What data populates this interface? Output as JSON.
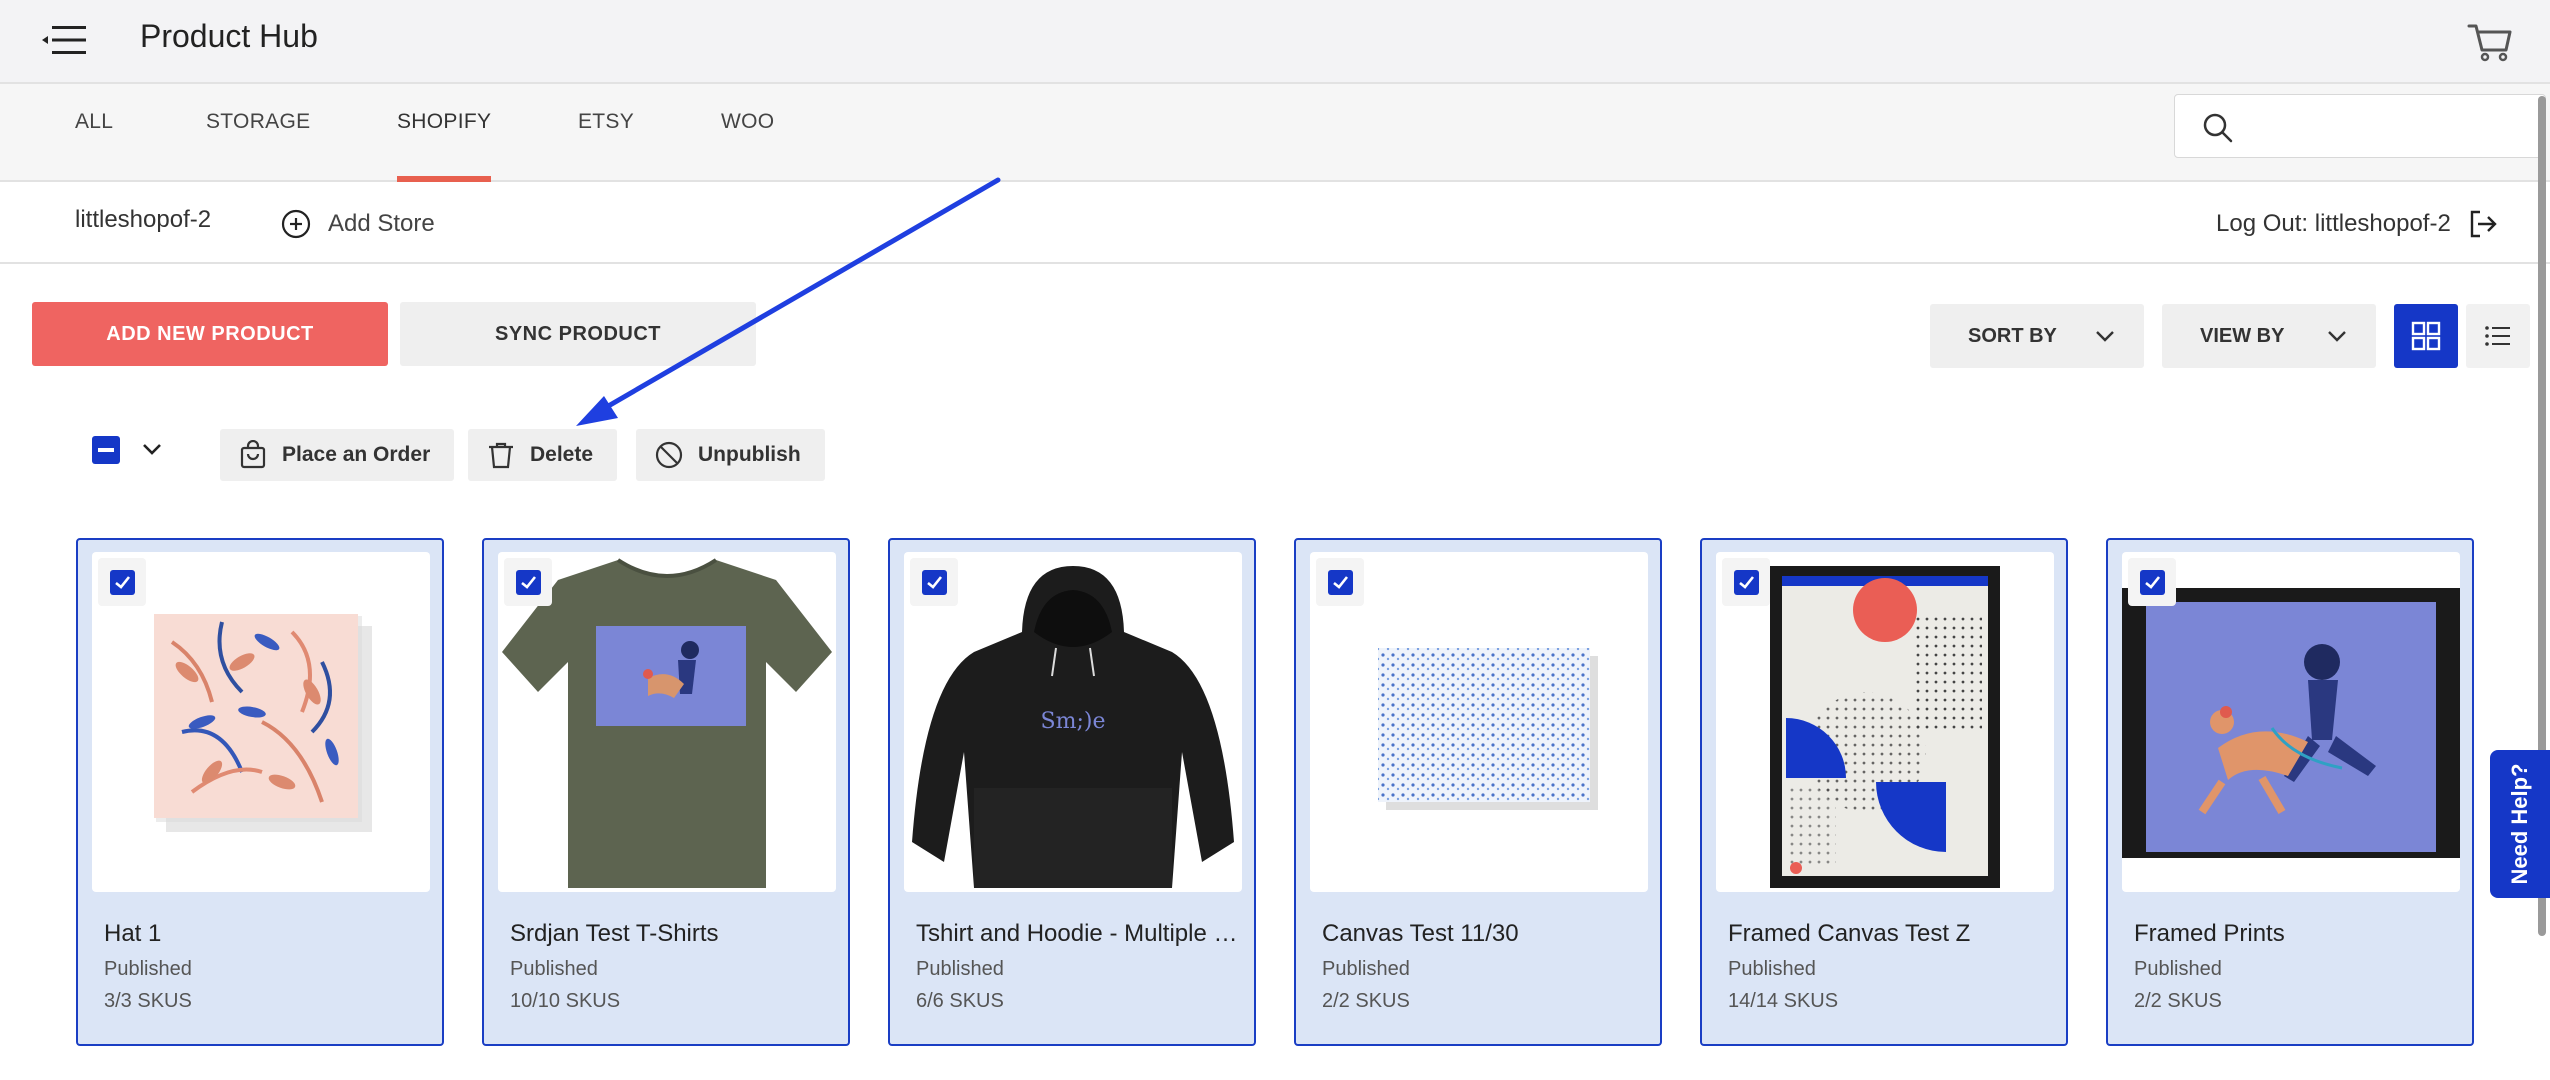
{
  "app": {
    "title": "Product Hub"
  },
  "tabs": [
    {
      "label": "ALL",
      "active": false
    },
    {
      "label": "STORAGE",
      "active": false
    },
    {
      "label": "SHOPIFY",
      "active": true
    },
    {
      "label": "ETSY",
      "active": false
    },
    {
      "label": "WOO",
      "active": false
    }
  ],
  "search": {
    "placeholder": ""
  },
  "store": {
    "name": "littleshopof-2",
    "add_store_label": "Add Store",
    "logout_label": "Log Out: littleshopof-2"
  },
  "actions": {
    "add_new_product": "ADD NEW PRODUCT",
    "sync_product": "SYNC PRODUCT",
    "sort_by": "SORT BY",
    "view_by": "VIEW BY"
  },
  "bulk": {
    "place_order": "Place an Order",
    "delete": "Delete",
    "unpublish": "Unpublish"
  },
  "products": [
    {
      "name": "Hat 1",
      "status": "Published",
      "skus": "3/3 SKUS",
      "selected": true,
      "image": "floral-canvas"
    },
    {
      "name": "Srdjan Test T-Shirts",
      "status": "Published",
      "skus": "10/10 SKUS",
      "selected": true,
      "image": "olive-tshirt"
    },
    {
      "name": "Tshirt and Hoodie - Multiple Products",
      "status": "Published",
      "skus": "6/6 SKUS",
      "selected": true,
      "image": "black-hoodie",
      "print_text": "Sm;)e"
    },
    {
      "name": "Canvas Test 11/30",
      "status": "Published",
      "skus": "2/2 SKUS",
      "selected": true,
      "image": "dotted-canvas"
    },
    {
      "name": "Framed Canvas Test Z",
      "status": "Published",
      "skus": "14/14 SKUS",
      "selected": true,
      "image": "geometric-framed-print"
    },
    {
      "name": "Framed Prints",
      "status": "Published",
      "skus": "2/2 SKUS",
      "selected": true,
      "image": "girl-dog-framed-print"
    }
  ],
  "help": {
    "label": "Need Help?"
  },
  "colors": {
    "accent": "#1537c7",
    "primary_button": "#ef6461",
    "tab_underline": "#e8604f",
    "card_bg": "#dbe5f6"
  }
}
